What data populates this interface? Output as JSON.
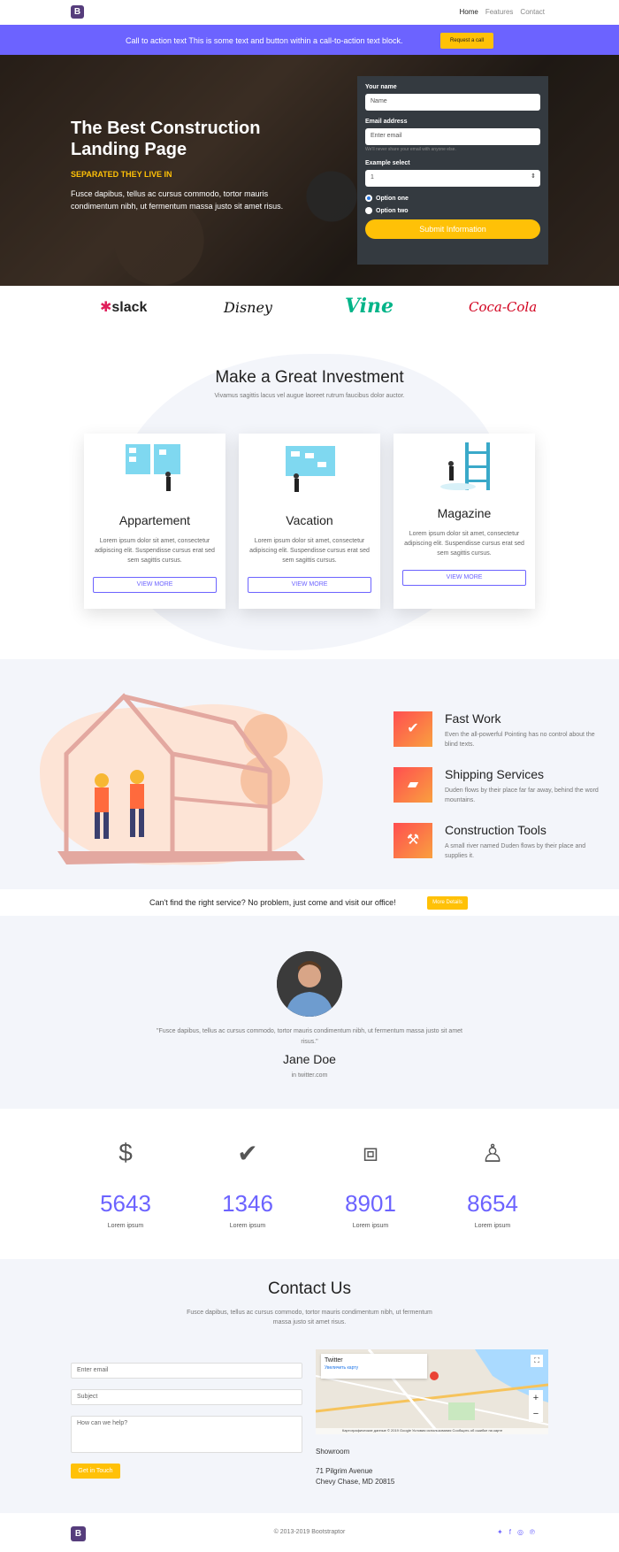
{
  "nav": {
    "brand": "B",
    "links": [
      "Home",
      "Features",
      "Contact"
    ]
  },
  "cta": {
    "text": "Call to action text This is some text and button within a call-to-action text block.",
    "button": "Request a call"
  },
  "hero": {
    "title": "The Best Construction Landing Page",
    "subtitle": "SEPARATED THEY LIVE IN",
    "text": "Fusce dapibus, tellus ac cursus commodo, tortor mauris condimentum nibh, ut fermentum massa justo sit amet risus."
  },
  "form": {
    "name_label": "Your name",
    "name_placeholder": "Name",
    "email_label": "Email address",
    "email_placeholder": "Enter email",
    "email_help": "We'll never share your email with anyone else.",
    "select_label": "Example select",
    "select_value": "1",
    "option1": "Option one",
    "option2": "Option two",
    "submit": "Submit Information"
  },
  "logos": [
    "slack",
    "Disney",
    "Vine",
    "Coca-Cola"
  ],
  "investment": {
    "title": "Make a Great Investment",
    "lead": "Vivamus sagittis lacus vel augue laoreet rutrum faucibus dolor auctor.",
    "cards": [
      {
        "title": "Appartement",
        "text": "Lorem ipsum dolor sit amet, consectetur adipiscing elit. Suspendisse cursus erat sed sem sagittis cursus.",
        "button": "VIEW MORE"
      },
      {
        "title": "Vacation",
        "text": "Lorem ipsum dolor sit amet, consectetur adipiscing elit. Suspendisse cursus erat sed sem sagittis cursus.",
        "button": "VIEW MORE"
      },
      {
        "title": "Magazine",
        "text": "Lorem ipsum dolor sit amet, consectetur adipiscing elit. Suspendisse cursus erat sed sem sagittis cursus.",
        "button": "VIEW MORE"
      }
    ]
  },
  "features": [
    {
      "icon": "check-icon",
      "title": "Fast Work",
      "text": "Even the all-powerful Pointing has no control about the blind texts."
    },
    {
      "icon": "truck-icon",
      "title": "Shipping Services",
      "text": "Duden flows by their place far far away, behind the word mountains."
    },
    {
      "icon": "tools-icon",
      "title": "Construction Tools",
      "text": "A small river named Duden flows by their place and supplies it."
    }
  ],
  "service": {
    "text": "Can't find the right service? No problem, just come and visit our office!",
    "button": "More Details"
  },
  "testimonial": {
    "quote": "\"Fusce dapibus, tellus ac cursus commodo, tortor mauris condimentum nibh, ut fermentum massa justo sit amet risus.\"",
    "name": "Jane Doe",
    "source": "in twitter.com"
  },
  "stats": [
    {
      "icon": "dollar-icon",
      "value": "5643",
      "label": "Lorem ipsum"
    },
    {
      "icon": "check-icon",
      "value": "1346",
      "label": "Lorem ipsum"
    },
    {
      "icon": "cubes-icon",
      "value": "8901",
      "label": "Lorem ipsum"
    },
    {
      "icon": "child-icon",
      "value": "8654",
      "label": "Lorem ipsum"
    }
  ],
  "contact": {
    "title": "Contact Us",
    "lead": "Fusce dapibus, tellus ac cursus commodo, tortor mauris condimentum nibh, ut fermentum massa justo sit amet risus.",
    "email_placeholder": "Enter email",
    "subject_placeholder": "Subject",
    "message_placeholder": "How can we help?",
    "button": "Get in Touch",
    "map_place": "Twitter",
    "map_link": "Увеличить карту",
    "map_footer": "Картографические данные © 2019 Google   Условия использования   Сообщить об ошибке на карте",
    "showroom": "Showroom",
    "address1": "71 Pilgrim Avenue",
    "address2": "Chevy Chase, MD 20815"
  },
  "footer": {
    "brand": "B",
    "copyright": "© 2013-2019 Bootstraptor",
    "social": [
      "twitter-icon",
      "facebook-icon",
      "instagram-icon",
      "pinterest-icon"
    ]
  },
  "colors": {
    "accent": "#6c63ff",
    "yellow": "#ffc107",
    "dark": "#343a40",
    "light_bg": "#f3f5fa"
  }
}
